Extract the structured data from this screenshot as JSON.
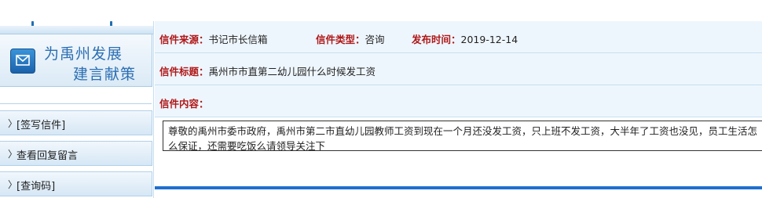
{
  "sidebar": {
    "banner_line1": "为禹州发展",
    "banner_line2": "建言献策",
    "menu": [
      {
        "arrow": "〉",
        "label": "[签写信件]"
      },
      {
        "arrow": "〉",
        "label": "查看回复留言"
      },
      {
        "arrow": "〉",
        "label": "[查询码]"
      }
    ]
  },
  "letter": {
    "source_label": "信件来源：",
    "source_value": "书记市长信箱",
    "type_label": "信件类型：",
    "type_value": "咨询",
    "date_label": "发布时间：",
    "date_value": "2019-12-14",
    "title_label": "信件标题：",
    "title_value": "禹州市市直第二幼儿园什么时候发工资",
    "content_label": "信件内容：",
    "content_value": "尊敬的禹州市委市政府，禹州市第二市直幼儿园教师工资到现在一个月还没发工资，只上班不发工资，大半年了工资也没见，员工生活怎么保证，还需要吃饭么请领导关注下"
  },
  "colors": {
    "label_red": "#b01818",
    "accent_blue": "#1f6fd0",
    "row_bg": "#eef6fd"
  },
  "icons": {
    "banner": "mail-envelope-icon"
  }
}
